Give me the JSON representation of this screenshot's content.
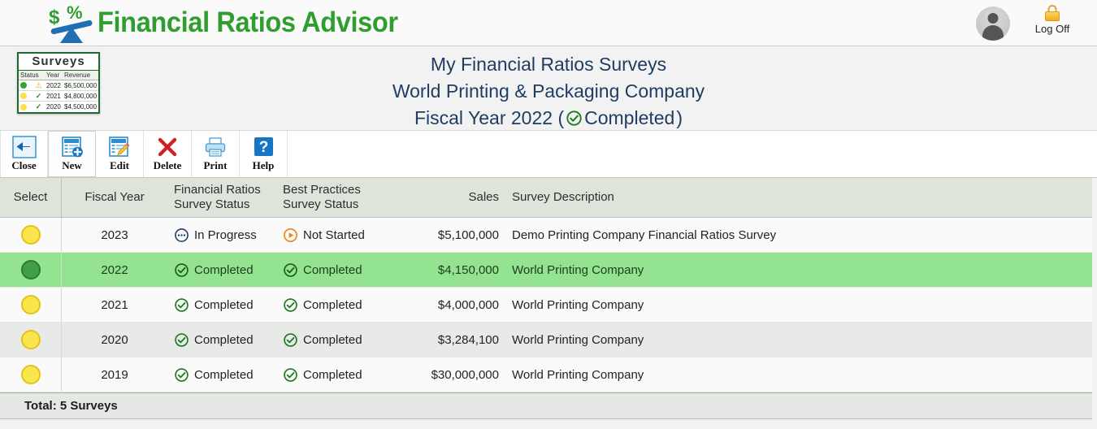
{
  "app": {
    "brand_name": "Financial Ratios Advisor",
    "logo_dollar": "$",
    "logo_percent": "%"
  },
  "account": {
    "avatar_name": "user-avatar",
    "logoff_label": "Log Off"
  },
  "title": {
    "line1": "My Financial Ratios Surveys",
    "line2": "World Printing & Packaging Company",
    "line3_prefix": "Fiscal Year 2022 (",
    "line3_status": "Completed",
    "line3_suffix": ")"
  },
  "surveys_legend": {
    "title": "Surveys",
    "headers": [
      "Status",
      "Year",
      "Revenue"
    ],
    "rows": [
      {
        "dot": "green",
        "mark": "warning",
        "year": "2022",
        "revenue": "$6,500,000"
      },
      {
        "dot": "yellow",
        "mark": "check",
        "year": "2021",
        "revenue": "$4,800,000"
      },
      {
        "dot": "yellow",
        "mark": "check",
        "year": "2020",
        "revenue": "$4,500,000"
      }
    ]
  },
  "toolbar": {
    "buttons": [
      {
        "label": "Close",
        "icon": "back-arrow-icon"
      },
      {
        "label": "New",
        "icon": "new-document-icon"
      },
      {
        "label": "Edit",
        "icon": "edit-pencil-icon"
      },
      {
        "label": "Delete",
        "icon": "delete-x-icon"
      },
      {
        "label": "Print",
        "icon": "printer-icon"
      },
      {
        "label": "Help",
        "icon": "question-mark-icon"
      }
    ]
  },
  "table": {
    "headers": {
      "select": "Select",
      "fiscal_year": "Fiscal Year",
      "fr_status_l1": "Financial Ratios",
      "fr_status_l2": "Survey Status",
      "bp_status_l1": "Best Practices",
      "bp_status_l2": "Survey Status",
      "sales": "Sales",
      "description": "Survey Description"
    },
    "rows": [
      {
        "selected": false,
        "fiscal_year": "2023",
        "fr_status": "In Progress",
        "fr_icon": "in-progress-icon",
        "bp_status": "Not Started",
        "bp_icon": "not-started-icon",
        "sales": "$5,100,000",
        "description": "Demo Printing Company Financial Ratios Survey"
      },
      {
        "selected": true,
        "fiscal_year": "2022",
        "fr_status": "Completed",
        "fr_icon": "completed-icon",
        "bp_status": "Completed",
        "bp_icon": "completed-icon",
        "sales": "$4,150,000",
        "description": "World Printing Company"
      },
      {
        "selected": false,
        "fiscal_year": "2021",
        "fr_status": "Completed",
        "fr_icon": "completed-icon",
        "bp_status": "Completed",
        "bp_icon": "completed-icon",
        "sales": "$4,000,000",
        "description": "World Printing Company"
      },
      {
        "selected": false,
        "fiscal_year": "2020",
        "fr_status": "Completed",
        "fr_icon": "completed-icon",
        "bp_status": "Completed",
        "bp_icon": "completed-icon",
        "sales": "$3,284,100",
        "description": "World Printing Company"
      },
      {
        "selected": false,
        "fiscal_year": "2019",
        "fr_status": "Completed",
        "fr_icon": "completed-icon",
        "bp_status": "Completed",
        "bp_icon": "completed-icon",
        "sales": "$30,000,000",
        "description": "World Printing Company"
      }
    ]
  },
  "footer": {
    "total_label": "Total: 5 Surveys"
  },
  "colors": {
    "brand_green": "#2f9e2f",
    "logo_blue": "#1f6fb2",
    "title_navy": "#1f3d63",
    "header_green": "#dde5db",
    "selected_row": "#93e391",
    "status_completed": "#1e7a1e",
    "status_in_progress": "#1f3d63",
    "status_not_started": "#f08a1c",
    "radio_yellow": "#fbe54d",
    "radio_selected": "#3f9e46"
  }
}
